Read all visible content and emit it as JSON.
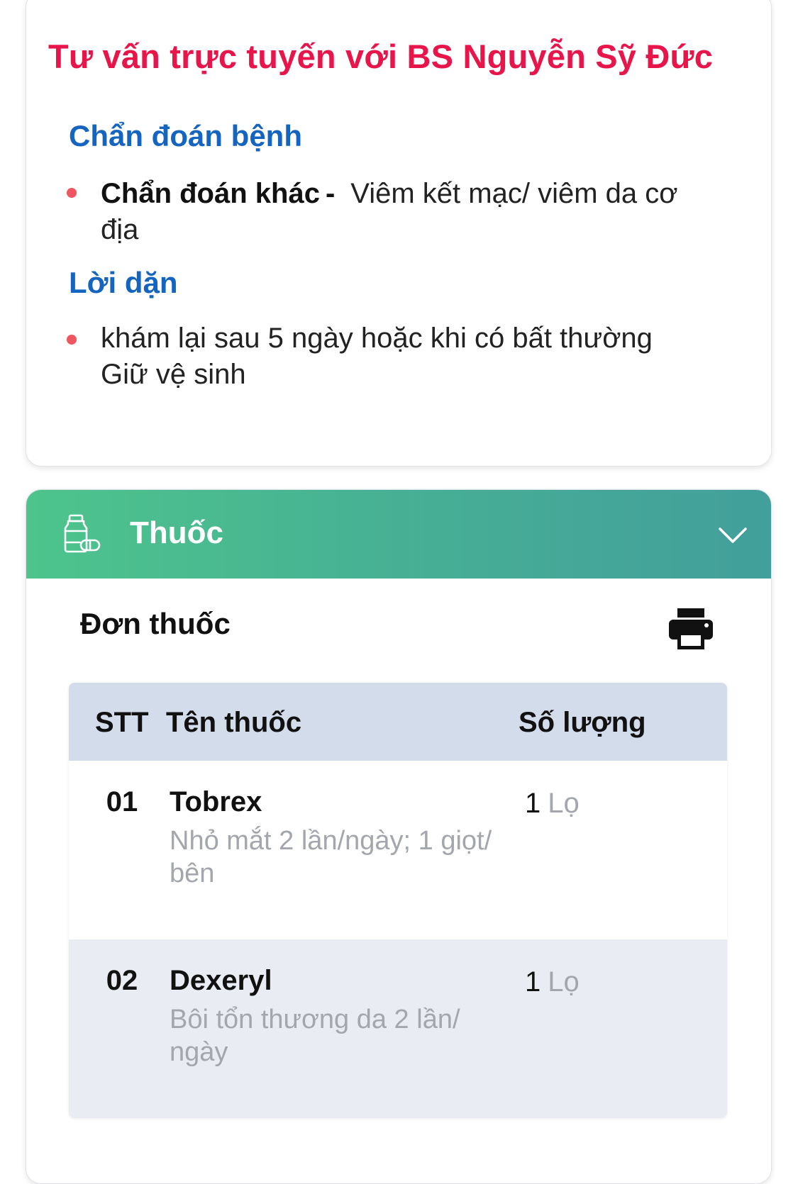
{
  "consultation": {
    "title": "Tư vấn trực tuyến với BS Nguyễn Sỹ Đức",
    "diagnosis": {
      "heading": "Chẩn đoán bệnh",
      "items": [
        {
          "label": "Chẩn đoán khác",
          "separator": "-",
          "value_line1": "Viêm kết mạc/ viêm da cơ",
          "value_line2": "địa"
        }
      ]
    },
    "advice": {
      "heading": "Lời dặn",
      "items": [
        {
          "line1": "khám lại sau 5 ngày hoặc khi có bất thường",
          "line2": "Giữ vệ sinh"
        }
      ]
    }
  },
  "medicine": {
    "header_title": "Thuốc",
    "header_icon": "medicine-bottle-pill-icon",
    "collapse_icon": "chevron-down-icon",
    "prescription_title": "Đơn thuốc",
    "print_icon": "printer-icon",
    "table": {
      "columns": [
        "STT",
        "Tên thuốc",
        "Số lượng"
      ],
      "rows": [
        {
          "stt": "01",
          "name": "Tobrex",
          "usage_line1": "Nhỏ mắt 2 lần/ngày; 1 giọt/",
          "usage_line2": "bên",
          "qty": "1",
          "unit": "Lọ"
        },
        {
          "stt": "02",
          "name": "Dexeryl",
          "usage_line1": "Bôi tổn thương da 2 lần/",
          "usage_line2": "ngày",
          "qty": "1",
          "unit": "Lọ"
        }
      ]
    }
  },
  "colors": {
    "title_red": "#e8154b",
    "heading_blue": "#1565c0",
    "bullet_red": "#f0565f",
    "header_green_start": "#4dc48c",
    "header_green_end": "#429f9b",
    "table_header_bg": "#d3dcea",
    "row_alt_bg": "#e9edf3",
    "muted_text": "#a3a6ad"
  }
}
